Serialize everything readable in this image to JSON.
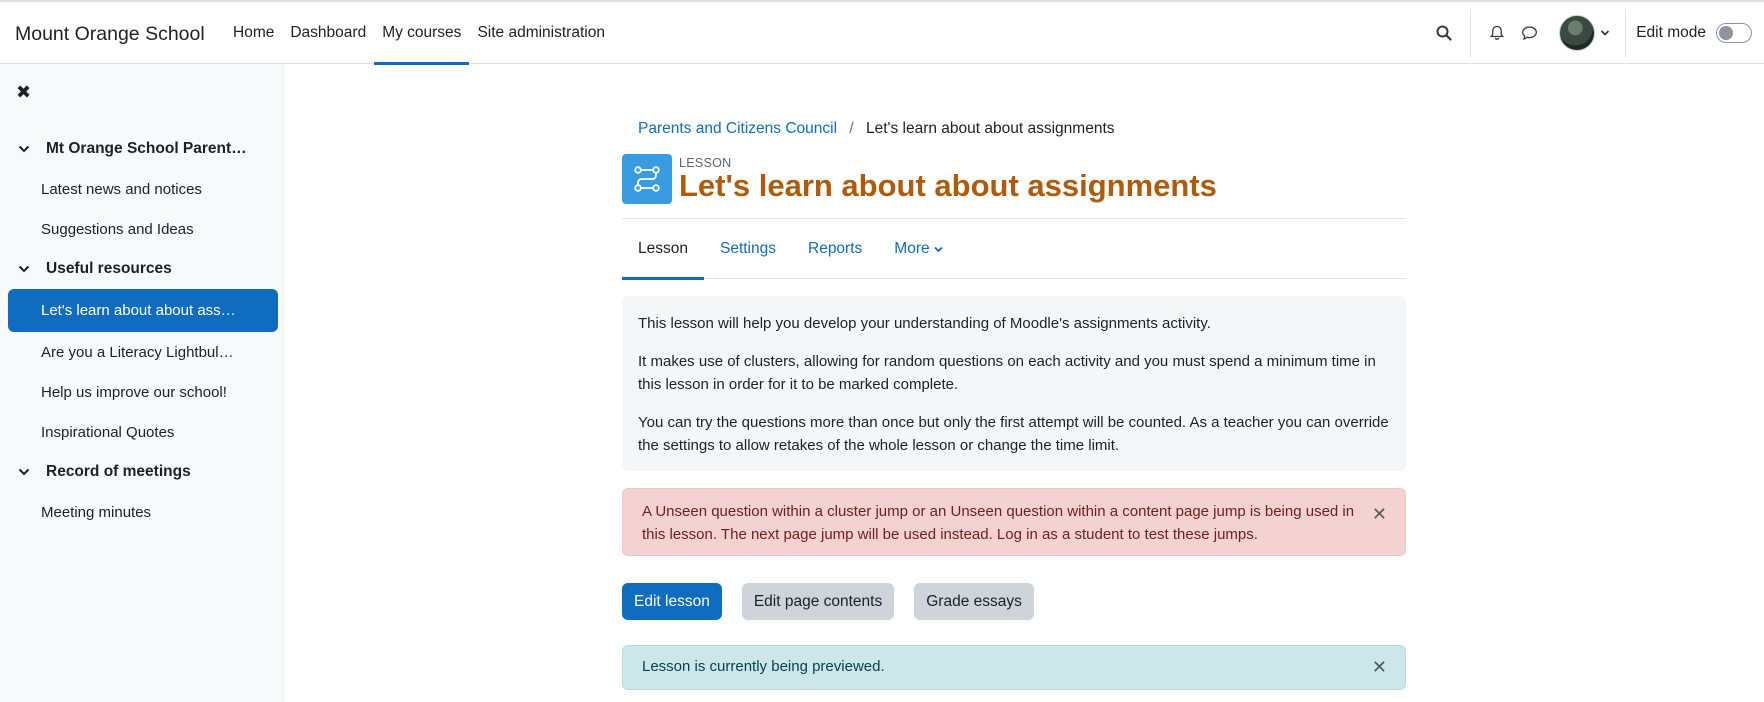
{
  "navbar": {
    "brand": "Mount Orange School",
    "items": [
      {
        "label": "Home",
        "active": false
      },
      {
        "label": "Dashboard",
        "active": false
      },
      {
        "label": "My courses",
        "active": true
      },
      {
        "label": "Site administration",
        "active": false
      }
    ],
    "edit_mode_label": "Edit mode",
    "edit_mode_on": false
  },
  "drawer": {
    "close_icon": "close-icon",
    "sections": [
      {
        "title": "Mt Orange School Parent…",
        "items": [
          "Latest news and notices",
          "Suggestions and Ideas"
        ]
      },
      {
        "title": "Useful resources",
        "items": [
          "Let's learn about about ass…",
          "Are you a Literacy Lightbul…",
          "Help us improve our school!",
          "Inspirational Quotes"
        ]
      },
      {
        "title": "Record of meetings",
        "items": [
          "Meeting minutes"
        ]
      }
    ],
    "active_item": "Let's learn about about ass…"
  },
  "breadcrumb": {
    "parent": "Parents and Citizens Council",
    "separator": "/",
    "current": "Let's learn about about assignments"
  },
  "page": {
    "activity_type": "LESSON",
    "title": "Let's learn about about assignments"
  },
  "tabs": [
    {
      "label": "Lesson",
      "active": true
    },
    {
      "label": "Settings",
      "active": false
    },
    {
      "label": "Reports",
      "active": false
    },
    {
      "label": "More",
      "active": false
    }
  ],
  "intro": {
    "paragraphs": [
      "This lesson will help you develop your understanding of Moodle's assignments activity.",
      "It makes use of clusters, allowing for random questions on each activity and you must spend a minimum time in this lesson in order for it to be marked complete.",
      "You can try the questions more than once but only the first attempt will be counted. As a teacher you can override the settings to allow retakes of the whole lesson or change the time limit."
    ]
  },
  "alerts": {
    "warning": "A Unseen question within a cluster jump or an Unseen question within a content page jump is being used in this lesson. The next page jump will be used instead. Log in as a student to test these jumps.",
    "info": "Lesson is currently being previewed."
  },
  "buttons": {
    "edit_lesson": "Edit lesson",
    "edit_page_contents": "Edit page contents",
    "grade_essays": "Grade essays"
  },
  "colors": {
    "primary": "#0f6cbf",
    "title": "#b15a0c",
    "activity_icon": "#399be2",
    "danger_bg": "#f5d2d2",
    "info_bg": "#cce6ea"
  }
}
